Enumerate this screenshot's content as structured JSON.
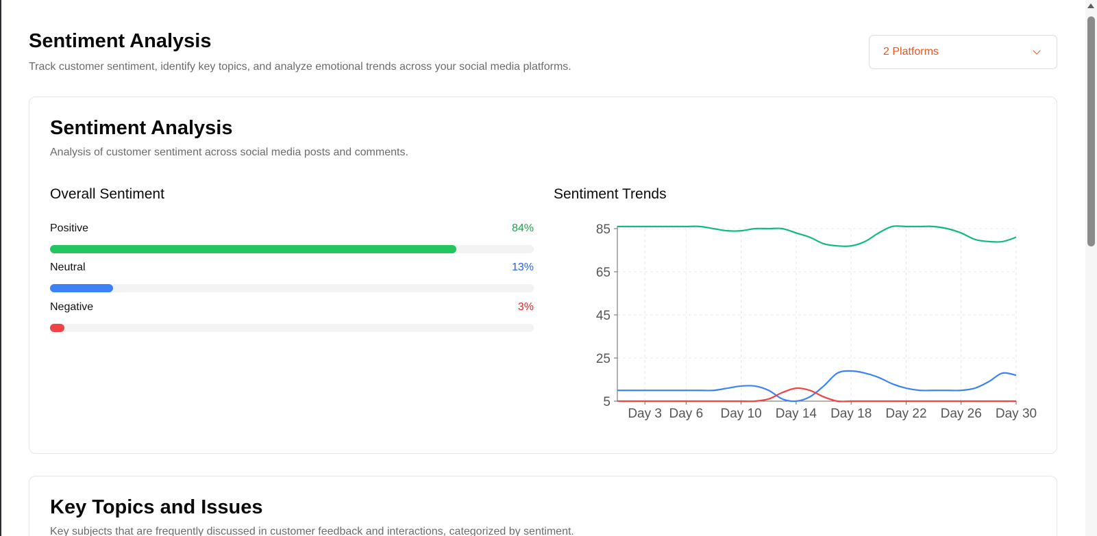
{
  "header": {
    "title": "Sentiment Analysis",
    "subtitle": "Track customer sentiment, identify key topics, and analyze emotional trends across your social media platforms.",
    "platform_select": "2 Platforms"
  },
  "sentiment_card": {
    "title": "Sentiment Analysis",
    "subtitle": "Analysis of customer sentiment across social media posts and comments.",
    "overall_title": "Overall Sentiment",
    "trends_title": "Sentiment Trends",
    "bars": [
      {
        "label": "Positive",
        "pct_text": "84%",
        "value": 84,
        "color": "#22c55e",
        "text_color": "#16a34a"
      },
      {
        "label": "Neutral",
        "pct_text": "13%",
        "value": 13,
        "color": "#3b82f6",
        "text_color": "#2563eb"
      },
      {
        "label": "Negative",
        "pct_text": "3%",
        "value": 3,
        "color": "#ef4444",
        "text_color": "#dc2626"
      }
    ]
  },
  "topics_card": {
    "title": "Key Topics and Issues",
    "subtitle": "Key subjects that are frequently discussed in customer feedback and interactions, categorized by sentiment."
  },
  "chart_data": {
    "type": "line",
    "x": [
      1,
      2,
      3,
      4,
      5,
      6,
      7,
      8,
      9,
      10,
      11,
      12,
      13,
      14,
      15,
      16,
      17,
      18,
      19,
      20,
      21,
      22,
      23,
      24,
      25,
      26,
      27,
      28,
      29,
      30
    ],
    "x_tick_labels": [
      "Day 3",
      "Day 6",
      "Day 10",
      "Day 14",
      "Day 18",
      "Day 22",
      "Day 26",
      "Day 30"
    ],
    "x_tick_values": [
      3,
      6,
      10,
      14,
      18,
      22,
      26,
      30
    ],
    "yticks": [
      5,
      25,
      45,
      65,
      85
    ],
    "ylim": [
      5,
      85
    ],
    "grid": true,
    "legend_position": "bottom",
    "series": [
      {
        "name": "Positive",
        "color": "#10b981",
        "values": [
          86,
          86,
          86,
          86,
          86,
          86,
          86,
          85,
          84,
          84,
          85,
          85,
          85,
          83,
          81,
          78,
          77,
          77,
          79,
          83,
          86,
          86,
          86,
          86,
          85,
          83,
          80,
          79,
          79,
          81
        ]
      },
      {
        "name": "Neutral",
        "color": "#3b82f6",
        "values": [
          10,
          10,
          10,
          10,
          10,
          10,
          10,
          10,
          11,
          12,
          12,
          10,
          6,
          5,
          7,
          12,
          18,
          19,
          18,
          16,
          13,
          11,
          10,
          10,
          10,
          10,
          11,
          14,
          18,
          17
        ]
      },
      {
        "name": "Negative",
        "color": "#ef4444",
        "values": [
          5,
          5,
          5,
          5,
          5,
          5,
          5,
          5,
          5,
          5,
          5,
          6,
          9,
          11,
          10,
          7,
          5,
          5,
          5,
          5,
          5,
          5,
          5,
          5,
          5,
          5,
          5,
          5,
          5,
          5
        ]
      }
    ]
  }
}
